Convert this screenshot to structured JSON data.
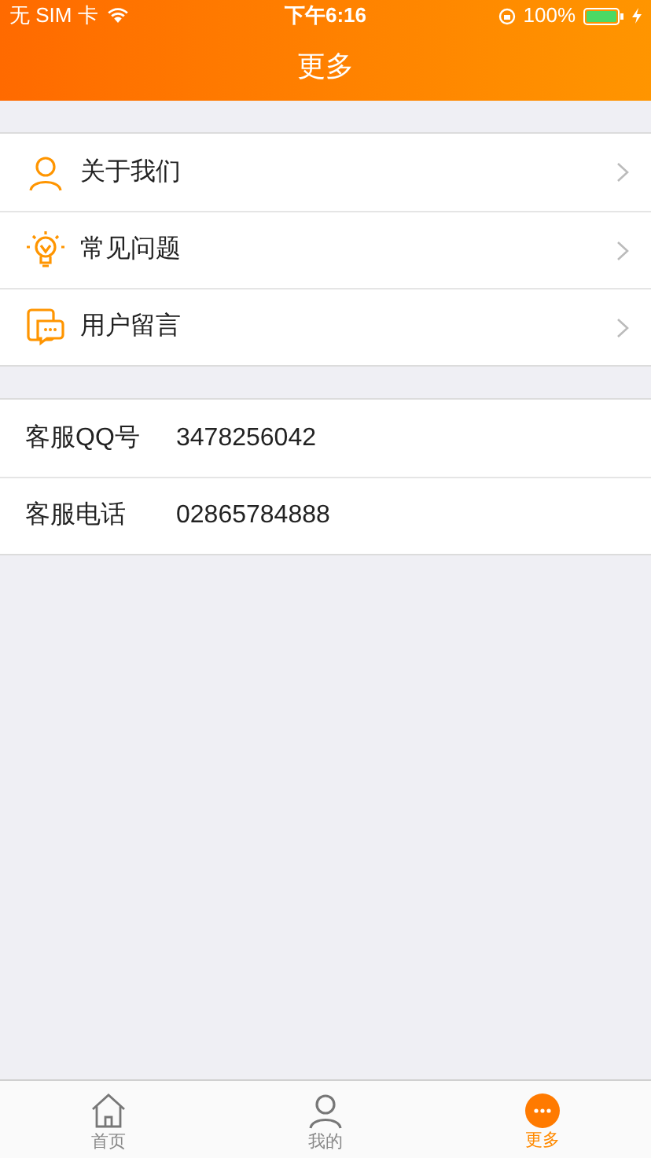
{
  "status_bar": {
    "carrier": "无 SIM 卡",
    "time": "下午6:16",
    "battery": "100%"
  },
  "nav": {
    "title": "更多"
  },
  "menu": [
    {
      "kind": "person",
      "label": "关于我们"
    },
    {
      "kind": "bulb",
      "label": "常见问题"
    },
    {
      "kind": "chat",
      "label": "用户留言"
    }
  ],
  "contacts": [
    {
      "label": "客服QQ号",
      "value": "3478256042"
    },
    {
      "label": "客服电话",
      "value": "02865784888"
    }
  ],
  "tabs": [
    {
      "kind": "home",
      "label": "首页",
      "selected": false
    },
    {
      "kind": "person",
      "label": "我的",
      "selected": false
    },
    {
      "kind": "more",
      "label": "更多",
      "selected": true
    }
  ]
}
